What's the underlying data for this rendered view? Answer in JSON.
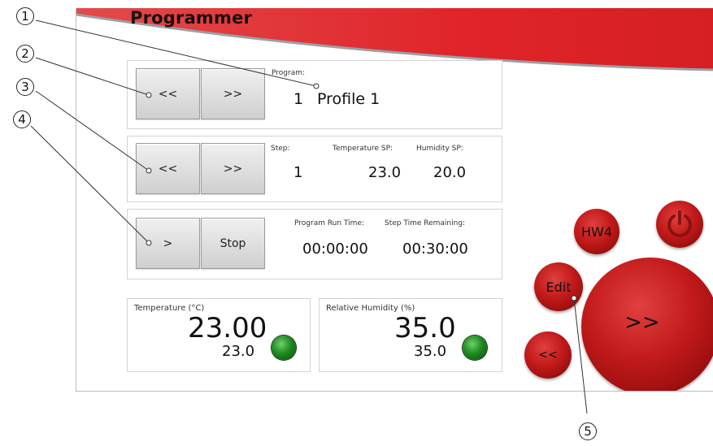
{
  "header": {
    "title": "Programmer"
  },
  "program": {
    "label": "Program:",
    "number": "1",
    "name": "Profile 1",
    "prev_label": "<<",
    "next_label": ">>"
  },
  "step": {
    "label": "Step:",
    "value": "1",
    "temp_sp_label": "Temperature SP:",
    "temp_sp_value": "23.0",
    "hum_sp_label": "Humidity SP:",
    "hum_sp_value": "20.0",
    "prev_label": "<<",
    "next_label": ">>"
  },
  "run": {
    "run_label": ">",
    "stop_label": "Stop",
    "run_time_label": "Program Run Time:",
    "run_time_value": "00:00:00",
    "remaining_label": "Step Time Remaining:",
    "remaining_value": "00:30:00"
  },
  "temperature": {
    "label": "Temperature (°C)",
    "value": "23.00",
    "setpoint": "23.0",
    "status_color": "#1f8a1f"
  },
  "humidity": {
    "label": "Relative Humidity (%)",
    "value": "35.0",
    "setpoint": "35.0",
    "status_color": "#1f8a1f"
  },
  "nav": {
    "hw4_label": "HW4",
    "edit_label": "Edit",
    "forward_label": ">>",
    "back_label": "<<",
    "power_icon": "power-icon"
  },
  "callouts": [
    "1",
    "2",
    "3",
    "4",
    "5"
  ],
  "colors": {
    "banner": "#e0252a",
    "ball": "#c21a1a",
    "led": "#1f8a1f"
  }
}
